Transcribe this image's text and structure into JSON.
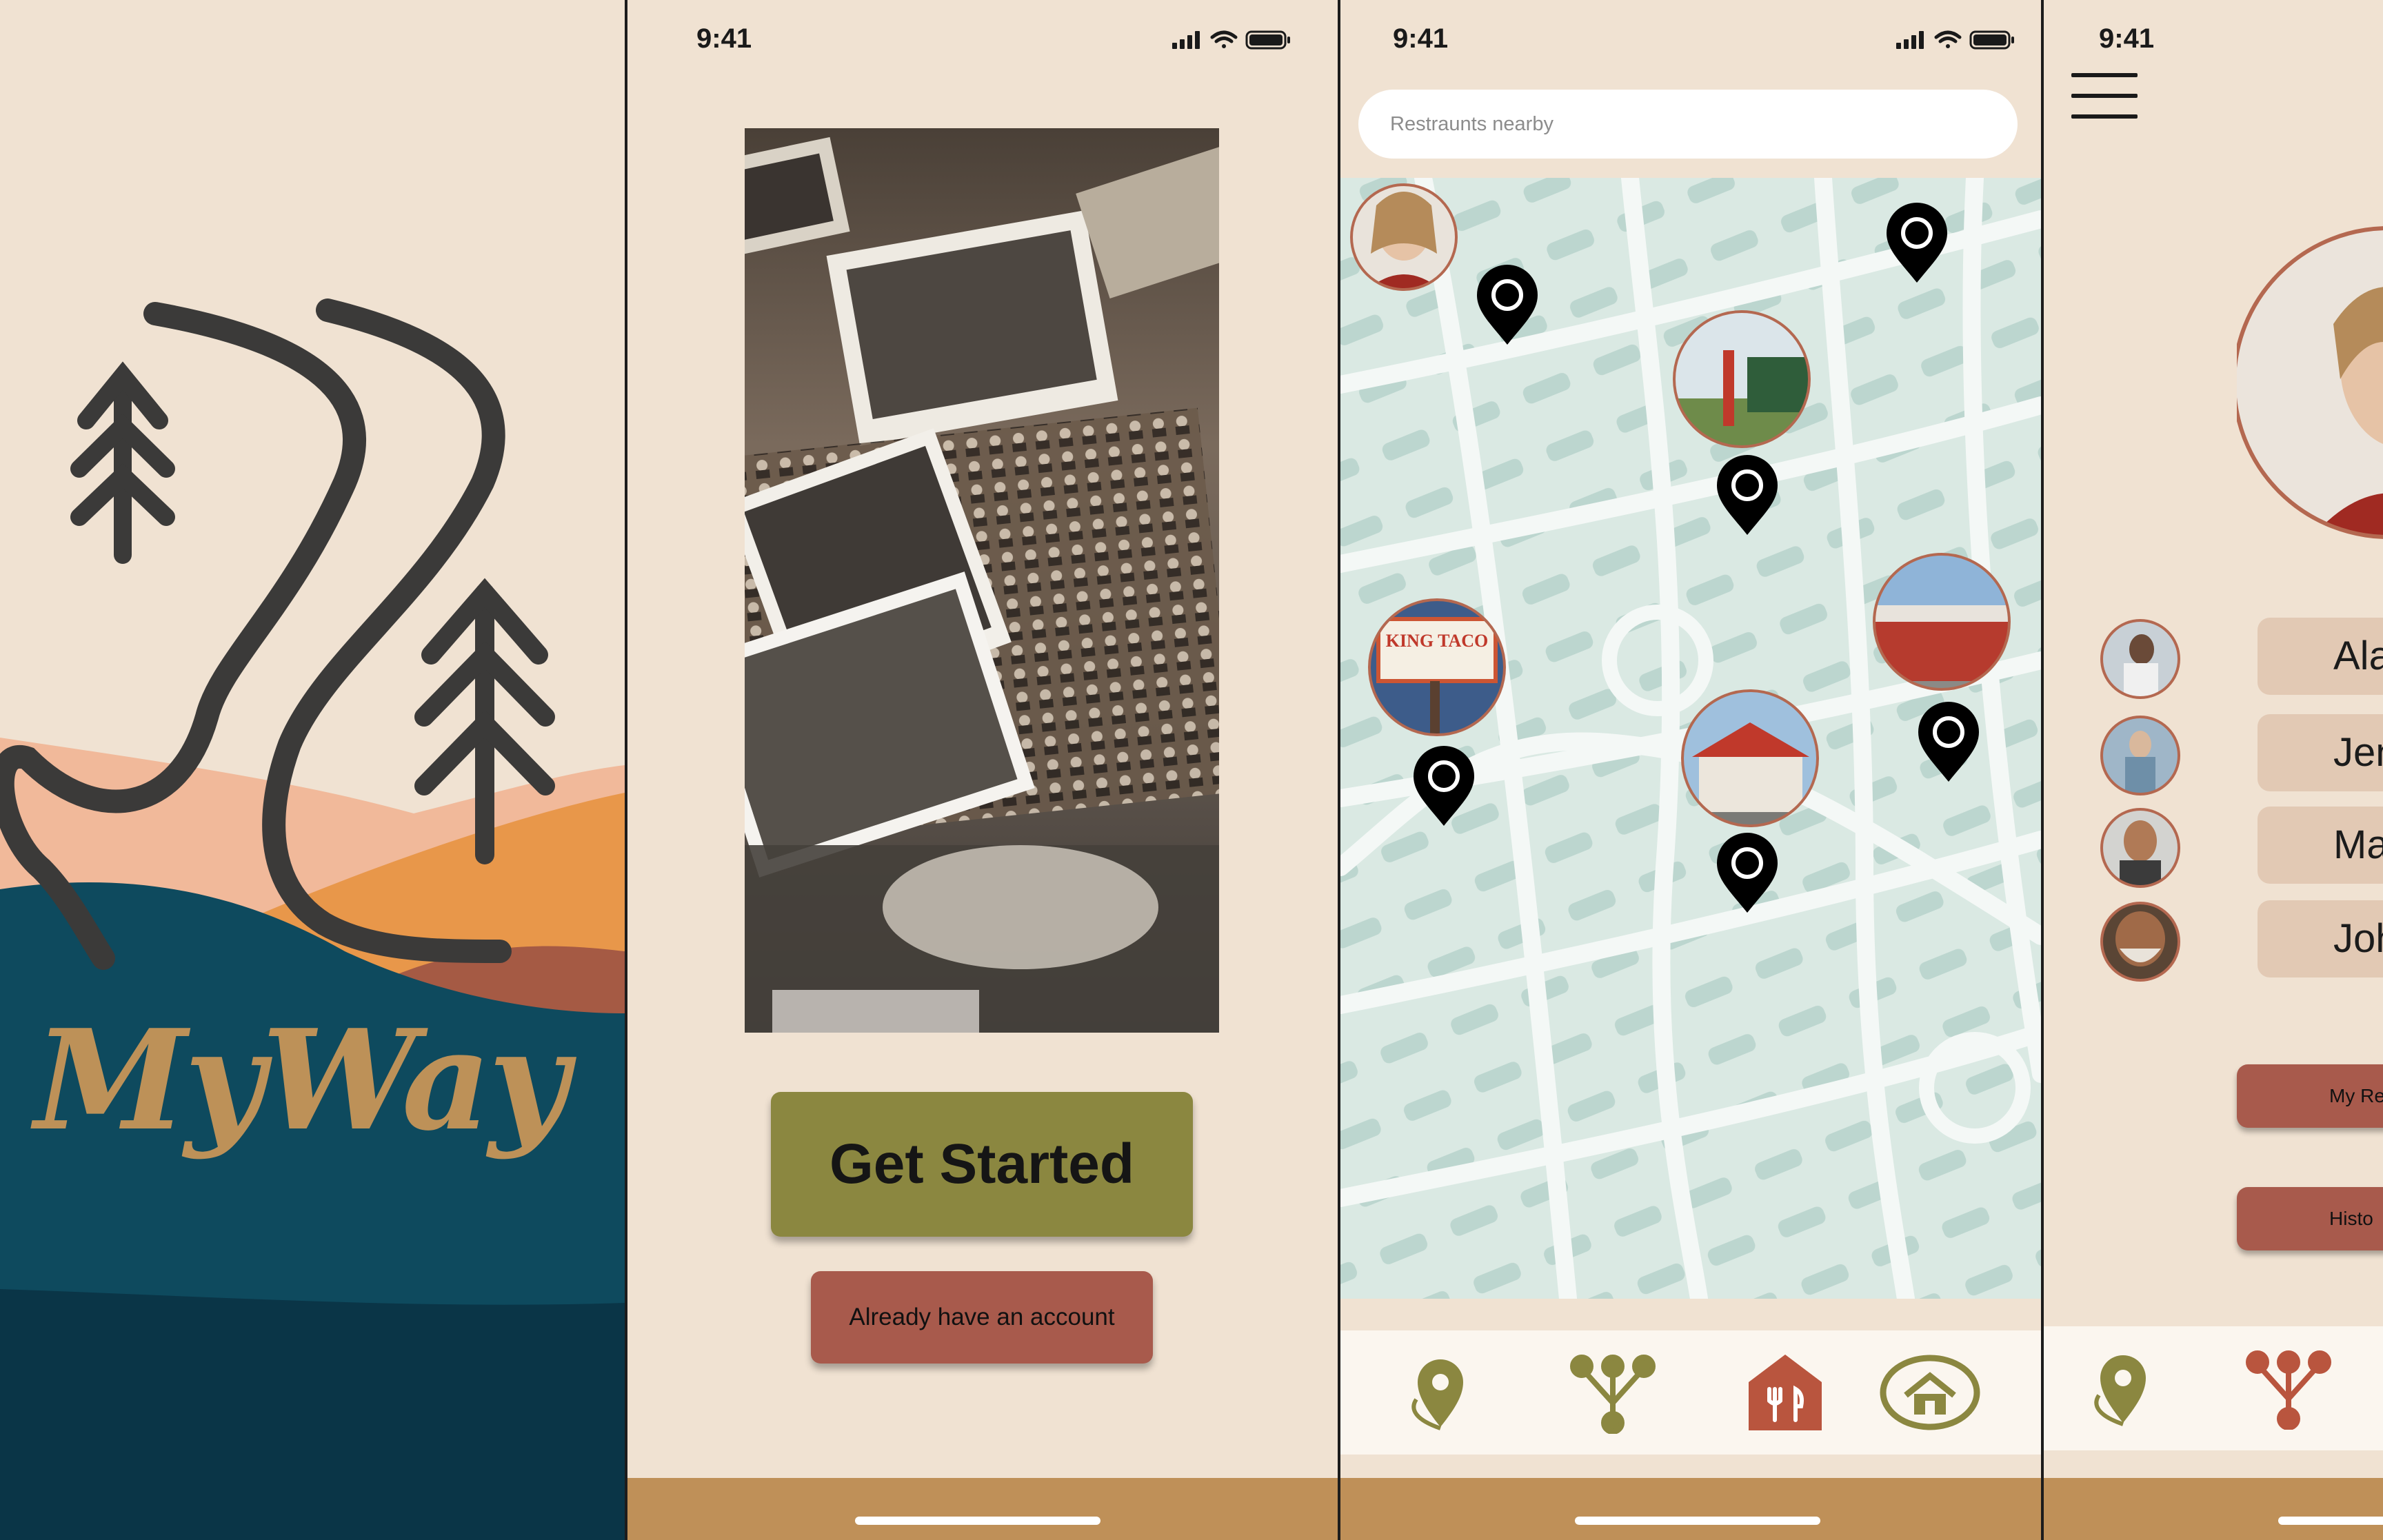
{
  "splash": {
    "logo_text": "MyWay",
    "colors": {
      "bg": "#f0e2d2",
      "peach": "#f1b99a",
      "orange": "#e8974a",
      "teal": "#0e4a5e",
      "brand_text": "#bd9158"
    }
  },
  "welcome": {
    "time": "9:41",
    "get_started_label": "Get Started",
    "account_label": "Already have an account"
  },
  "map_screen": {
    "time": "9:41",
    "search_placeholder": "Restraunts nearby",
    "nav": [
      "location-pin-icon",
      "network-icon",
      "restaurant-icon",
      "home-icon"
    ],
    "colors": {
      "map_bg": "#dae9e3",
      "street": "#f4f8f6",
      "block": "#bcd6cf",
      "olive": "#8b8740",
      "rust": "#b9553e"
    }
  },
  "profile_screen": {
    "time": "9:41",
    "contacts": [
      {
        "name": "Alan"
      },
      {
        "name": "Jenn"
      },
      {
        "name": "Martin"
      },
      {
        "name": "Johnn"
      }
    ],
    "buttons": [
      "My Re",
      "Histo"
    ]
  }
}
